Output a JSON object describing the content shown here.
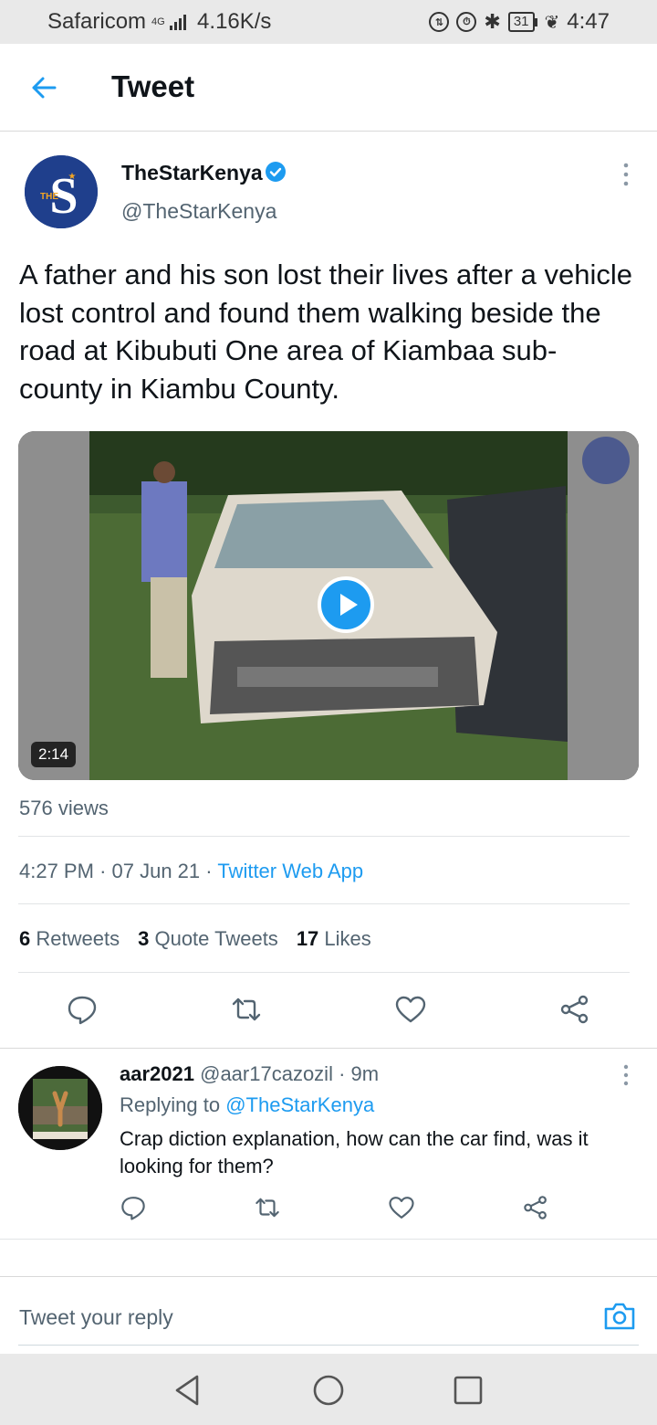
{
  "status": {
    "carrier": "Safaricom",
    "network": "4G",
    "speed": "4.16K/s",
    "battery": "31",
    "time": "4:47"
  },
  "header": {
    "title": "Tweet"
  },
  "tweet": {
    "author_name": "TheStarKenya",
    "author_handle": "@TheStarKenya",
    "avatar_text": "THE",
    "text": "A father and his son lost their lives after a vehicle lost control and found them walking beside the road at Kibubuti One area of Kiambaa sub-county in Kiambu County.",
    "video_duration": "2:14",
    "views": "576 views",
    "time": "4:27 PM",
    "date": "07 Jun 21",
    "source": "Twitter Web App",
    "retweets_count": "6",
    "retweets_label": "Retweets",
    "quotes_count": "3",
    "quotes_label": "Quote Tweets",
    "likes_count": "17",
    "likes_label": "Likes"
  },
  "reply": {
    "name": "aar2021",
    "handle": "@aar17cazozil",
    "age": "9m",
    "replying_label": "Replying to",
    "replying_to": "@TheStarKenya",
    "text": "Crap diction explanation, how can the car find, was it looking for them?"
  },
  "composer": {
    "placeholder": "Tweet your reply"
  },
  "colors": {
    "accent": "#1d9bf0",
    "verified": "#1d9bf0",
    "muted": "#536471"
  },
  "icons": [
    "back-arrow-icon",
    "verified-icon",
    "more-icon",
    "play-icon",
    "reply-icon",
    "retweet-icon",
    "like-icon",
    "share-icon",
    "camera-icon",
    "nav-back-icon",
    "nav-home-icon",
    "nav-recents-icon"
  ]
}
